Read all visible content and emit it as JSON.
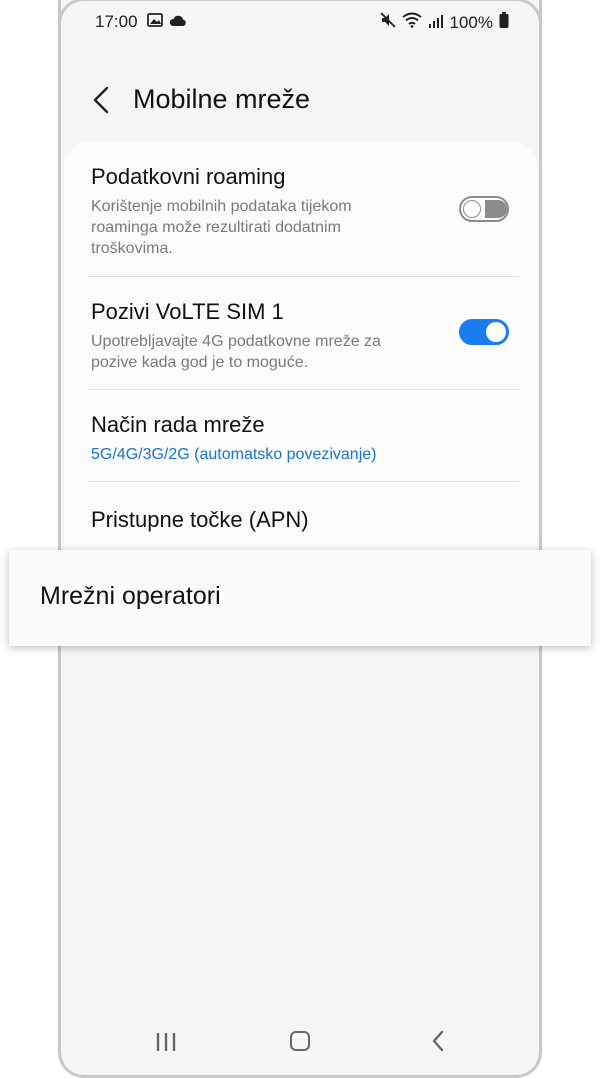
{
  "status_bar": {
    "time": "17:00",
    "battery": "100%",
    "icons": [
      "image-icon",
      "cloud-icon",
      "mute-icon",
      "wifi-icon",
      "signal-icon",
      "battery-icon"
    ]
  },
  "header": {
    "title": "Mobilne mreže",
    "back_icon": "back-arrow-icon"
  },
  "settings": [
    {
      "title": "Podatkovni roaming",
      "subtitle": "Korištenje mobilnih podataka tijekom roaminga može rezultirati dodatnim troškovima.",
      "toggle": "off"
    },
    {
      "title": "Pozivi VoLTE SIM 1",
      "subtitle": "Upotrebljavajte 4G podatkovne mreže za pozive kada god je to moguće.",
      "toggle": "on"
    },
    {
      "title": "Način rada mreže",
      "subtitle": "5G/4G/3G/2G (automatsko povezivanje)"
    },
    {
      "title": "Pristupne točke (APN)"
    }
  ],
  "highlight": {
    "label": "Mrežni operatori"
  },
  "colors": {
    "accent": "#1a7ef0",
    "link": "#1a73c9",
    "background": "#f6f6f6"
  },
  "navbar": {
    "icons": [
      "recent-apps-icon",
      "home-icon",
      "back-icon"
    ]
  }
}
